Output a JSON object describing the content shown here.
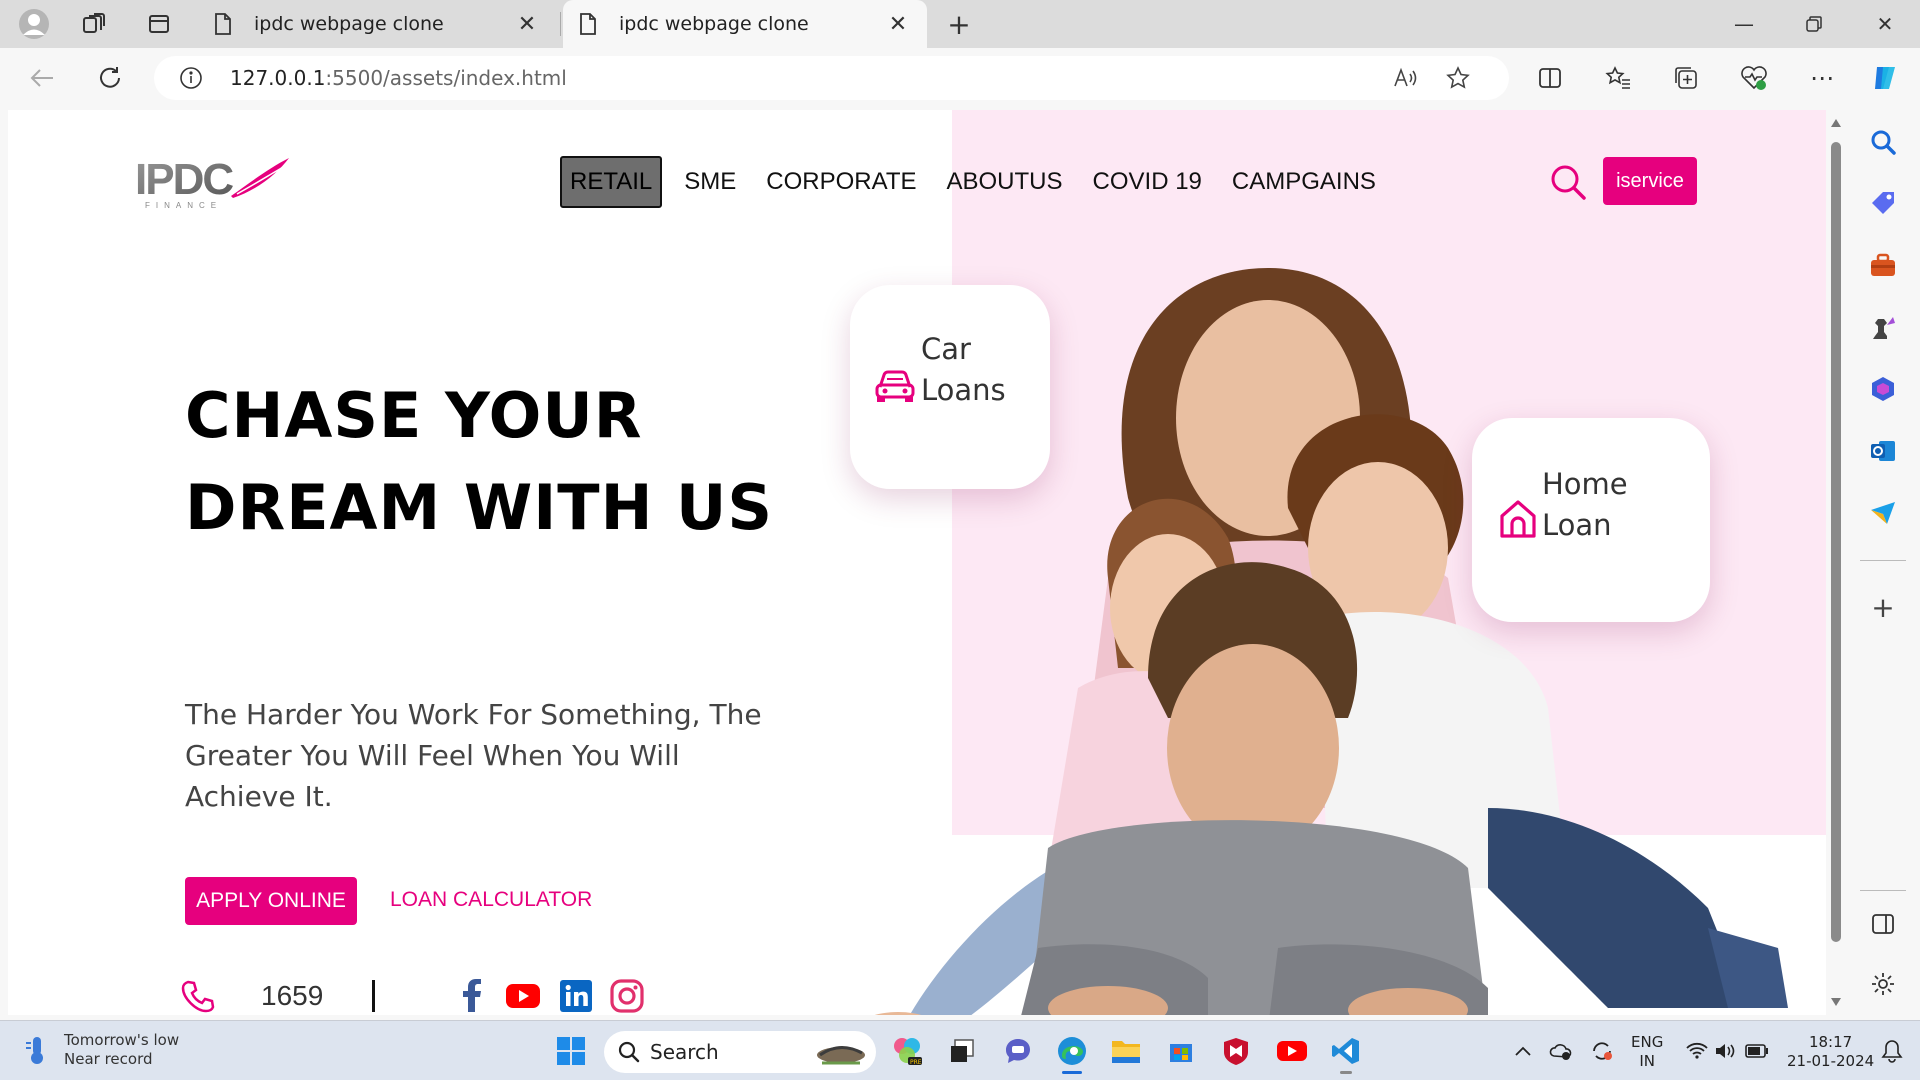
{
  "browser": {
    "tabs": [
      {
        "title": "ipdc webpage clone",
        "active": false
      },
      {
        "title": "ipdc webpage clone",
        "active": true
      }
    ],
    "url_host": "127.0.0.1",
    "url_path": ":5500/assets/index.html"
  },
  "site": {
    "logo_text": "IPDC",
    "logo_sub": "FINANCE",
    "menu": [
      "RETAIL",
      "SME",
      "CORPORATE",
      "ABOUTUS",
      "COVID 19",
      "CAMPGAINS"
    ],
    "active_menu": "RETAIL",
    "iservice": "iservice",
    "hero_title": "CHASE YOUR DREAM WITH US",
    "hero_subtitle": "The Harder You Work For Something, The Greater You Will Feel When You Will Achieve It.",
    "apply_button": "APPLY ONLINE",
    "calculator_link": "LOAN CALCULATOR",
    "hotline": "1659",
    "card_car": {
      "line1": "Car",
      "line2": "Loans"
    },
    "card_home": {
      "line1": "Home",
      "line2": "Loan"
    },
    "social": [
      "facebook-icon",
      "youtube-icon",
      "linkedin-icon",
      "instagram-icon"
    ],
    "accent": "#e6007e",
    "pink_bg": "#fde8f4"
  },
  "taskbar": {
    "weather_line1": "Tomorrow's low",
    "weather_line2": "Near record",
    "search": "Search",
    "lang1": "ENG",
    "lang2": "IN",
    "time": "18:17",
    "date": "21-01-2024"
  }
}
